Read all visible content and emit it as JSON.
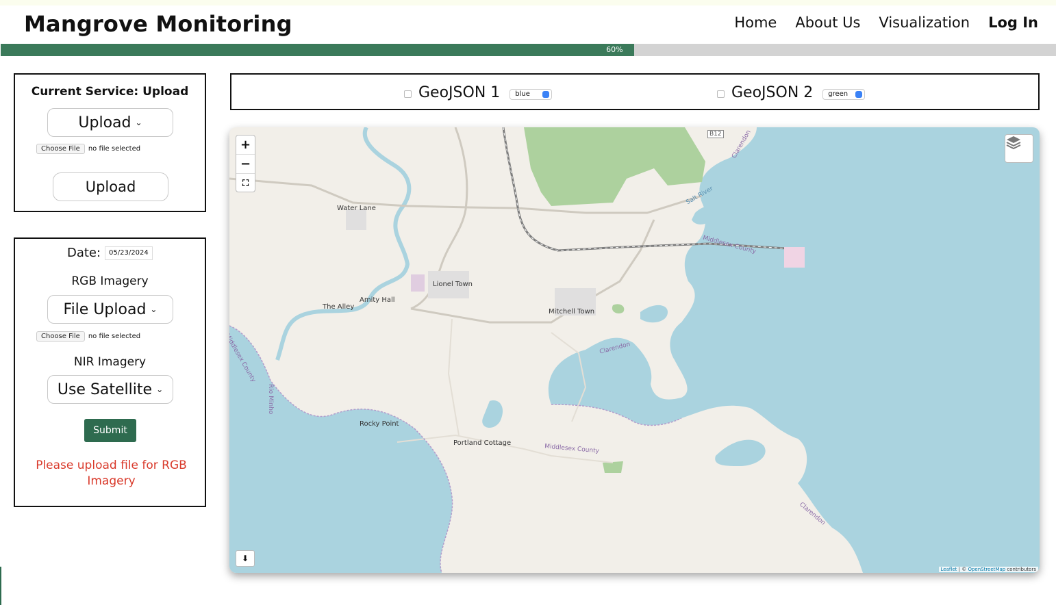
{
  "header": {
    "brand": "Mangrove Monitoring",
    "nav": [
      "Home",
      "About Us",
      "Visualization",
      "Log In"
    ]
  },
  "progress": {
    "value": 0.6,
    "label": "60%",
    "color": "#3b7a5a"
  },
  "service_panel": {
    "title": "Current Service: Upload",
    "dropdown_label": "Upload",
    "file_button": "Choose File",
    "file_status": "no file selected",
    "upload_button": "Upload"
  },
  "form_panel": {
    "date_label": "Date:",
    "date_value": "05/23/2024",
    "rgb_label": "RGB Imagery",
    "rgb_dropdown": "File Upload",
    "file_button": "Choose File",
    "file_status": "no file selected",
    "nir_label": "NIR Imagery",
    "nir_dropdown": "Use Satellite",
    "submit": "Submit",
    "error": "Please upload file for RGB Imagery",
    "error_color": "#d93a2b"
  },
  "geojson": [
    {
      "label": "GeoJSON 1",
      "color": "blue"
    },
    {
      "label": "GeoJSON 2",
      "color": "green"
    }
  ],
  "map": {
    "places": [
      "Water Lane",
      "Lionel Town",
      "Amity Hall",
      "The Alley",
      "Mitchell Town",
      "Rocky Point",
      "Portland Cottage"
    ],
    "boundaries": [
      "Middlesex County",
      "Clarendon",
      "Middlesex County",
      "Middlesex County",
      "Clarendon",
      "Clarendon",
      "Rio Minho",
      "Salt River",
      "B12"
    ],
    "attribution_leaflet": "Leaflet",
    "attribution_sep": "| ©",
    "attribution_osm": "OpenStreetMap",
    "attribution_tail": "contributors",
    "colors": {
      "water": "#aad3df",
      "land": "#f2efe9",
      "forest": "#add19e"
    }
  }
}
